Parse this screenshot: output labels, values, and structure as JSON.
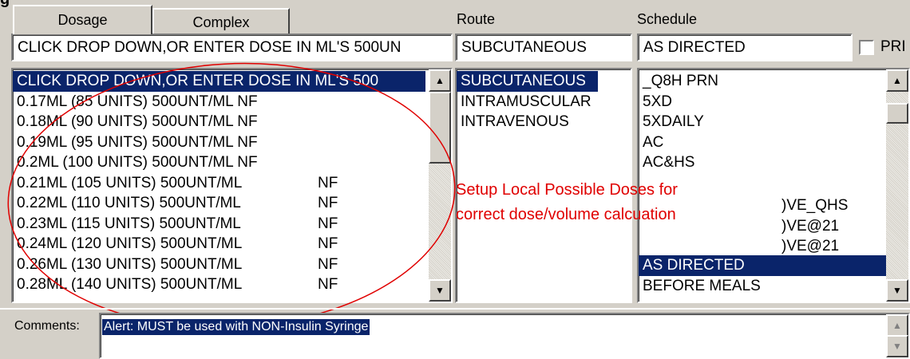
{
  "header": {
    "cut_text": "g"
  },
  "tabs": [
    {
      "label": "Dosage"
    },
    {
      "label": "Complex"
    }
  ],
  "route": {
    "label": "Route",
    "value": "SUBCUTANEOUS",
    "options": [
      "SUBCUTANEOUS",
      "INTRAMUSCULAR",
      "INTRAVENOUS"
    ]
  },
  "schedule": {
    "label": "Schedule",
    "value": "AS DIRECTED",
    "prn_label": "PRI",
    "options_top": [
      "_Q8H PRN",
      "5XD",
      "5XDAILY",
      "AC",
      "AC&HS"
    ],
    "options_partial": [
      ")VE_QHS",
      ")VE@21",
      ")VE@21"
    ],
    "options_bottom": [
      "AS DIRECTED",
      "BEFORE MEALS"
    ]
  },
  "dosage": {
    "input_value": "CLICK DROP DOWN,OR ENTER DOSE IN ML'S 500UN",
    "list": [
      {
        "text": "CLICK DROP DOWN,OR ENTER DOSE IN ML'S 500",
        "nf": ""
      },
      {
        "text": "0.17ML (85 UNITS) 500UNT/ML NF",
        "nf": ""
      },
      {
        "text": "0.18ML (90 UNITS) 500UNT/ML NF",
        "nf": ""
      },
      {
        "text": "0.19ML (95 UNITS) 500UNT/ML NF",
        "nf": ""
      },
      {
        "text": "0.2ML (100 UNITS) 500UNT/ML NF",
        "nf": ""
      },
      {
        "text": "0.21ML (105 UNITS) 500UNT/ML",
        "nf": "NF"
      },
      {
        "text": "0.22ML (110 UNITS) 500UNT/ML",
        "nf": "NF"
      },
      {
        "text": "0.23ML (115 UNITS) 500UNT/ML",
        "nf": "NF"
      },
      {
        "text": "0.24ML (120 UNITS) 500UNT/ML",
        "nf": "NF"
      },
      {
        "text": "0.26ML (130 UNITS) 500UNT/ML",
        "nf": "NF"
      },
      {
        "text": "0.28ML (140 UNITS) 500UNT/ML",
        "nf": "NF"
      }
    ]
  },
  "annotation": {
    "line1": "Setup Local Possible Doses for",
    "line2": "correct dose/volume calcuation",
    "color": "#e00000"
  },
  "comments": {
    "label": "Comments:",
    "value": "Alert: MUST be used with NON-Insulin Syringe"
  },
  "icons": {
    "scroll_up": "up-arrow-icon",
    "scroll_down": "down-arrow-icon"
  },
  "colors": {
    "selection": "#0a246a",
    "window": "#d4d0c8"
  }
}
